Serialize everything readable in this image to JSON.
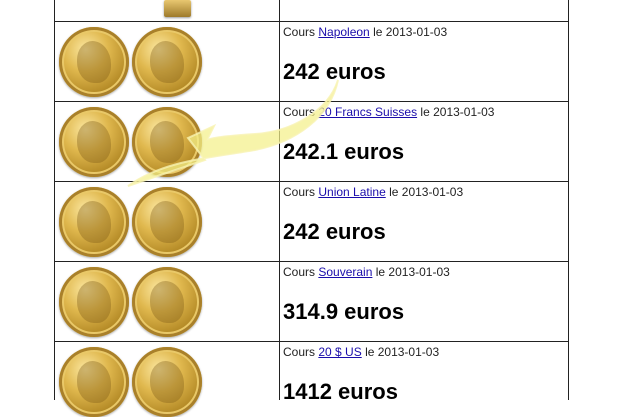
{
  "rows": [
    {
      "prefix": "Cours",
      "link": "Napoleon",
      "suffix": "le 2013-01-03",
      "price": "242 euros"
    },
    {
      "prefix": "Cours",
      "link": "20 Francs Suisses",
      "suffix": "le 2013-01-03",
      "price": "242.1 euros"
    },
    {
      "prefix": "Cours",
      "link": "Union Latine",
      "suffix": "le 2013-01-03",
      "price": "242 euros"
    },
    {
      "prefix": "Cours",
      "link": "Souverain",
      "suffix": "le 2013-01-03",
      "price": "314.9 euros"
    },
    {
      "prefix": "Cours",
      "link": "20 $ US",
      "suffix": "le 2013-01-03",
      "price": "1412 euros"
    }
  ],
  "colors": {
    "link": "#1a0dab",
    "border": "#222222",
    "gold": "#e0b84e",
    "arrow": "#f4f089"
  },
  "icons": [
    "gold-bar-icon",
    "coin-image",
    "arrow-overlay"
  ]
}
